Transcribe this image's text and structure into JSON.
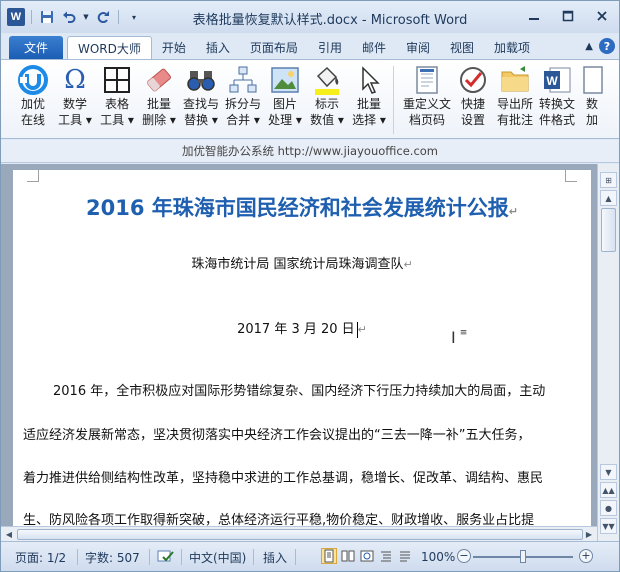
{
  "window": {
    "title": "表格批量恢复默认样式.docx - Microsoft Word",
    "app_icon": "W"
  },
  "tabs": {
    "file": "文件",
    "items": [
      "WORD大师",
      "开始",
      "插入",
      "页面布局",
      "引用",
      "邮件",
      "审阅",
      "视图",
      "加载项"
    ],
    "active": "WORD大师"
  },
  "ribbon": {
    "buttons": [
      {
        "line1": "加优",
        "line2": "在线",
        "icon": "jiayou-logo-icon"
      },
      {
        "line1": "数学",
        "line2": "工具 ▾",
        "icon": "omega-icon"
      },
      {
        "line1": "表格",
        "line2": "工具 ▾",
        "icon": "table-grid-icon"
      },
      {
        "line1": "批量",
        "line2": "删除 ▾",
        "icon": "eraser-icon"
      },
      {
        "line1": "查找与",
        "line2": "替换 ▾",
        "icon": "binoculars-icon"
      },
      {
        "line1": "拆分与",
        "line2": "合并 ▾",
        "icon": "hierarchy-icon"
      },
      {
        "line1": "图片",
        "line2": "处理 ▾",
        "icon": "picture-icon"
      },
      {
        "line1": "标示",
        "line2": "数值 ▾",
        "icon": "paint-bucket-icon"
      },
      {
        "line1": "批量",
        "line2": "选择 ▾",
        "icon": "cursor-arrow-icon"
      },
      {
        "line1": "重定义文",
        "line2": "档页码",
        "icon": "document-icon"
      },
      {
        "line1": "快捷",
        "line2": "设置",
        "icon": "checkmark-gauge-icon"
      },
      {
        "line1": "导出所",
        "line2": "有批注",
        "icon": "folder-icon"
      },
      {
        "line1": "转换文",
        "line2": "件格式",
        "icon": "word-document-icon"
      },
      {
        "line1": "数",
        "line2": "加",
        "icon": "document-icon"
      }
    ]
  },
  "webbar": {
    "text": "加优智能办公系统   http://www.jiayouoffice.com"
  },
  "document": {
    "title": "2016 年珠海市国民经济和社会发展统计公报",
    "author": "珠海市统计局  国家统计局珠海调查队",
    "date": "2017 年 3 月 20 日",
    "paragraph_lines": [
      "2016 年，全市积极应对国际形势错综复杂、国内经济下行压力持续加大的局面，主动",
      "适应经济发展新常态，坚决贯彻落实中央经济工作会议提出的“三去一降一补”五大任务，",
      "着力推进供给侧结构性改革，坚持稳中求进的工作总基调，稳增长、促改革、调结构、惠民",
      "生、防风险各项工作取得新突破，总体经济运行平稳,物价稳定、财政增收、服务业占比提"
    ],
    "para_mark": "↵"
  },
  "status": {
    "page": "页面: 1/2",
    "words": "字数: 507",
    "language": "中文(中国)",
    "mode": "插入",
    "zoom": "100%",
    "zoom_level_fraction": 0.5
  },
  "colors": {
    "title_blue": "#1f5fb0",
    "file_tab": "#2b6cc4"
  }
}
